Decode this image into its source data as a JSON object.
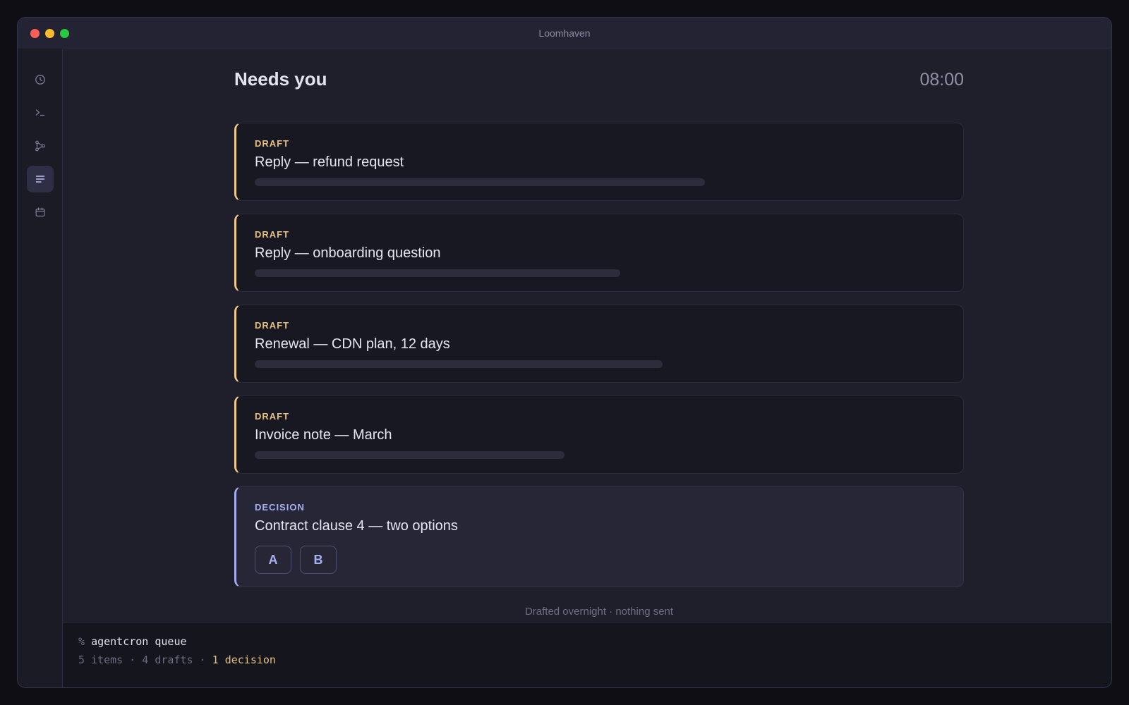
{
  "window": {
    "title": "Loomhaven"
  },
  "sidebar": {
    "items": [
      {
        "icon": "clock-icon",
        "active": false
      },
      {
        "icon": "terminal-icon",
        "active": false
      },
      {
        "icon": "branch-icon",
        "active": false
      },
      {
        "icon": "list-icon",
        "active": true
      },
      {
        "icon": "calendar-icon",
        "active": false
      }
    ]
  },
  "main": {
    "heading": "Needs you",
    "time": "08:00",
    "cards": [
      {
        "kind": "DRAFT",
        "title": "Reply — refund request"
      },
      {
        "kind": "DRAFT",
        "title": "Reply — onboarding question"
      },
      {
        "kind": "DRAFT",
        "title": "Renewal — CDN plan, 12 days"
      },
      {
        "kind": "DRAFT",
        "title": "Invoice note — March"
      },
      {
        "kind": "DECISION",
        "title": "Contract clause 4 — two options",
        "options": [
          "A",
          "B"
        ]
      }
    ],
    "footnote": "Drafted overnight · nothing sent"
  },
  "terminal": {
    "prompt": "%",
    "command": "agentcron queue",
    "output_prefix": "5 items · 4 drafts · ",
    "output_highlight": "1 decision"
  },
  "colors": {
    "draft_accent": "#f0c987",
    "decision_accent": "#a5adf0",
    "background": "#1f1f2c"
  }
}
